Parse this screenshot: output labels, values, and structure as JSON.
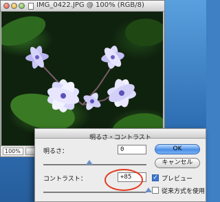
{
  "image_window": {
    "title": "IMG_0422.JPG @ 100% (RGB/8)",
    "zoom": "100%"
  },
  "dialog": {
    "title": "明るさ・コントラスト",
    "brightness_label": "明るさ：",
    "brightness_value": "0",
    "contrast_label": "コントラスト：",
    "contrast_value": "+85",
    "ok_label": "OK",
    "cancel_label": "キャンセル",
    "preview_label": "プレビュー",
    "preview_checked": true,
    "legacy_label": "従来方式を使用",
    "legacy_checked": false
  },
  "colors": {
    "annotation": "#e23a1e",
    "default_button": "#4b8fe6"
  }
}
